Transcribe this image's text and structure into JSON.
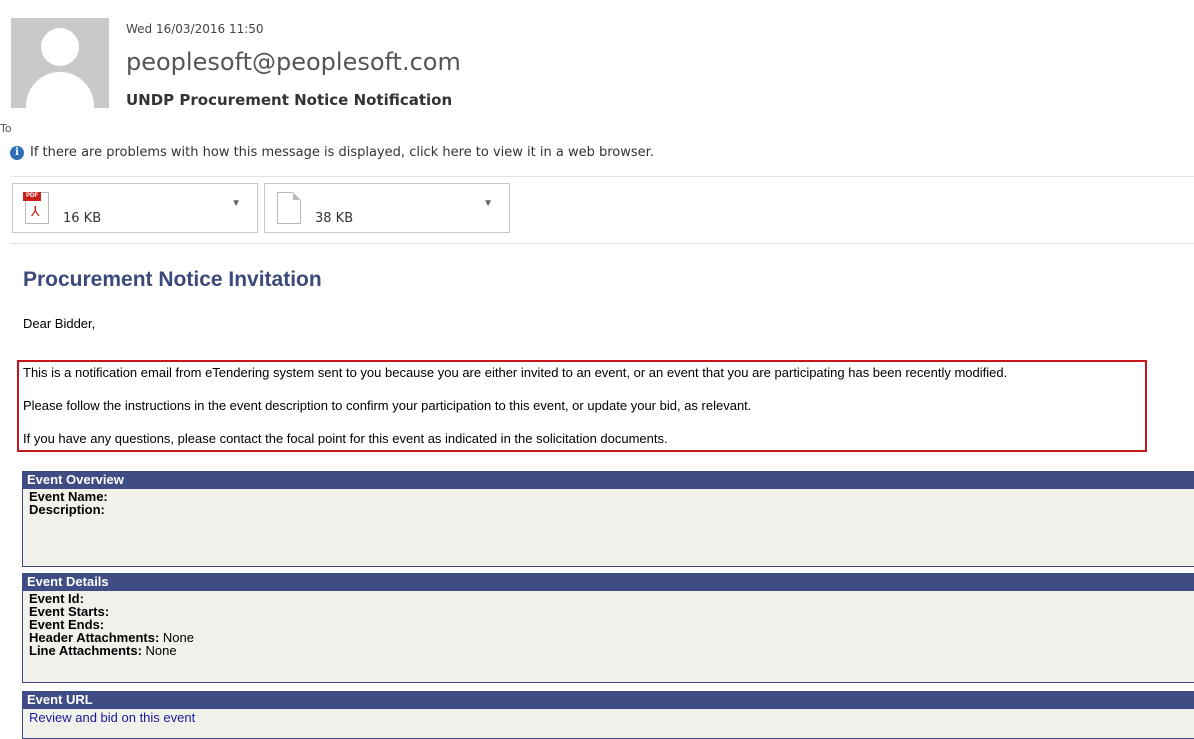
{
  "header": {
    "date": "Wed 16/03/2016 11:50",
    "sender": "peoplesoft@peoplesoft.com",
    "subject": "UNDP Procurement Notice Notification",
    "to_label": "To",
    "info_message": "If there are problems with how this message is displayed, click here to view it in a web browser."
  },
  "attachments": [
    {
      "icon": "pdf-icon",
      "icon_tag": "PDF",
      "size": "16 KB"
    },
    {
      "icon": "document-icon",
      "size": "38 KB"
    }
  ],
  "body": {
    "title": "Procurement Notice Invitation",
    "salutation": "Dear Bidder,",
    "paragraphs": [
      "This is a notification email from eTendering system sent to you because you are either invited to an event, or an event that you are participating has been recently modified.",
      "Please follow the instructions in the event description to confirm your participation to this event, or update your bid, as relevant.",
      "If you have any questions, please contact the focal point for this event as indicated in the solicitation documents."
    ]
  },
  "event_overview": {
    "heading": "Event Overview",
    "event_name_label": "Event Name:",
    "description_label": "Description:"
  },
  "event_details": {
    "heading": "Event Details",
    "event_id_label": "Event Id:",
    "event_starts_label": "Event Starts:",
    "event_ends_label": "Event Ends:",
    "header_attachments_label": "Header Attachments:",
    "header_attachments_value": "None",
    "line_attachments_label": "Line Attachments:",
    "line_attachments_value": "None"
  },
  "event_url": {
    "heading": "Event URL",
    "link_text": "Review and bid on this event"
  },
  "colors": {
    "section_header_bg": "#3f4d84",
    "title_color": "#3b4a7b",
    "highlight_border": "#c8161d",
    "link_color": "#1a1a9c"
  }
}
